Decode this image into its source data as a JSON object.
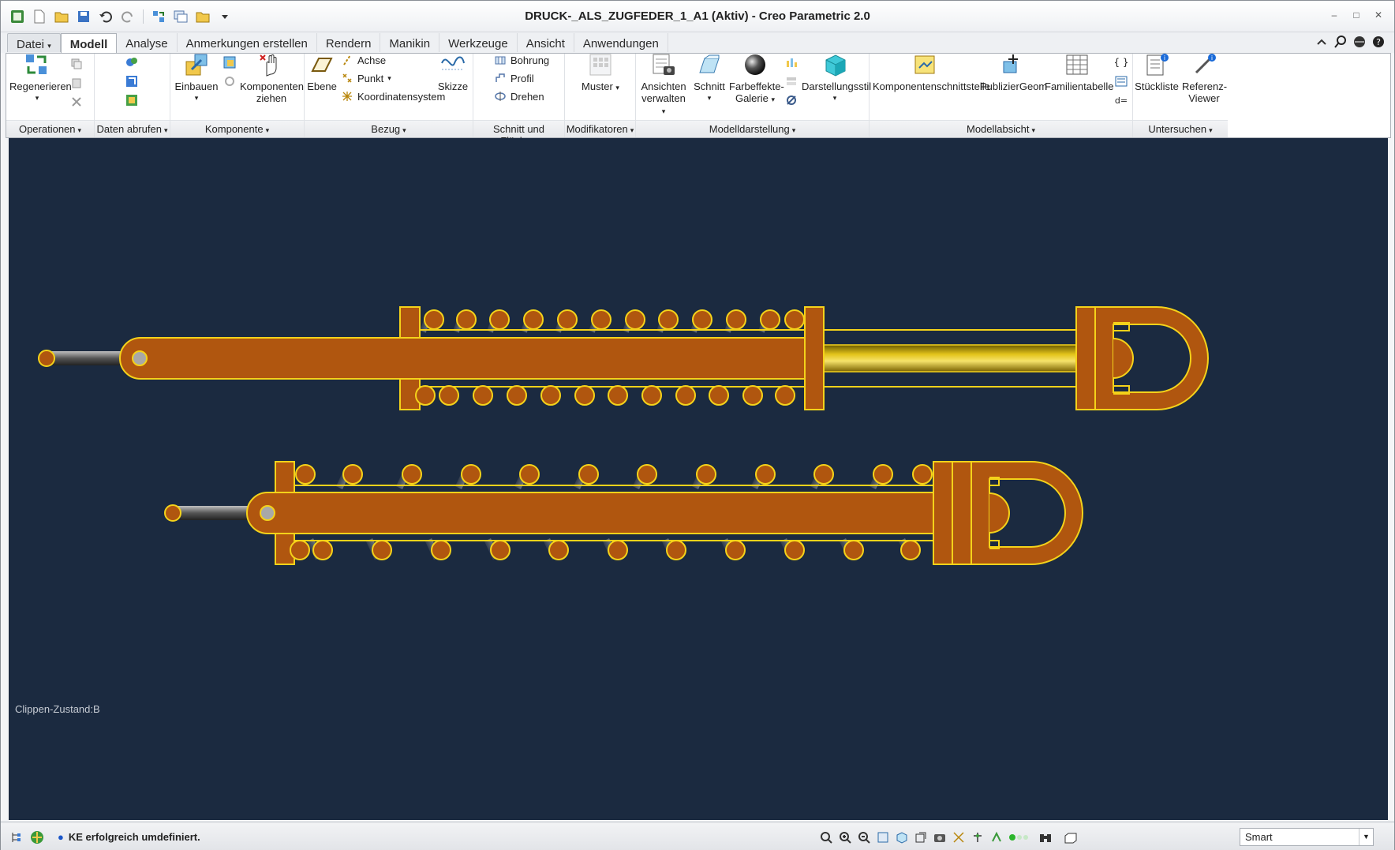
{
  "window": {
    "title": "DRUCK-_ALS_ZUGFEDER_1_A1 (Aktiv) - Creo Parametric 2.0"
  },
  "tabs": [
    {
      "label": "Datei"
    },
    {
      "label": "Modell",
      "active": true
    },
    {
      "label": "Analyse"
    },
    {
      "label": "Anmerkungen erstellen"
    },
    {
      "label": "Rendern"
    },
    {
      "label": "Manikin"
    },
    {
      "label": "Werkzeuge"
    },
    {
      "label": "Ansicht"
    },
    {
      "label": "Anwendungen"
    }
  ],
  "ribbon": {
    "groups": {
      "operationen": "Operationen",
      "daten_abrufen": "Daten abrufen",
      "komponente": "Komponente",
      "bezug": "Bezug",
      "schnitt_flaeche": "Schnitt und Fläche",
      "modifikatoren": "Modifikatoren",
      "modelldarstellung": "Modelldarstellung",
      "modellabsicht": "Modellabsicht",
      "untersuchen": "Untersuchen"
    },
    "buttons": {
      "regenerieren": "Regenerieren",
      "einbauen": "Einbauen",
      "komponenten_ziehen_1": "Komponenten",
      "komponenten_ziehen_2": "ziehen",
      "ebene": "Ebene",
      "achse": "Achse",
      "punkt": "Punkt",
      "koordinatensystem": "Koordinatensystem",
      "skizze": "Skizze",
      "bohrung": "Bohrung",
      "profil": "Profil",
      "drehen": "Drehen",
      "muster": "Muster",
      "ansichten_1": "Ansichten",
      "ansichten_2": "verwalten",
      "schnitt": "Schnitt",
      "farbeffekte_1": "Farbeffekte-",
      "farbeffekte_2": "Galerie",
      "darstellungsstil": "Darstellungsstil",
      "komponentenschnittstelle": "Komponentenschnittstelle",
      "publiziergeom": "PublizierGeom",
      "familientabelle": "Familientabelle",
      "stueckliste": "Stückliste",
      "referenz_1": "Referenz-",
      "referenz_2": "Viewer"
    }
  },
  "viewport": {
    "background": "#1b2a40",
    "part_color": "#b0560f",
    "edge_color": "#f4d21a",
    "clip_state": "Clippen-Zustand:B"
  },
  "status": {
    "message": "KE erfolgreich umdefiniert.",
    "selection_filter": "Smart"
  }
}
